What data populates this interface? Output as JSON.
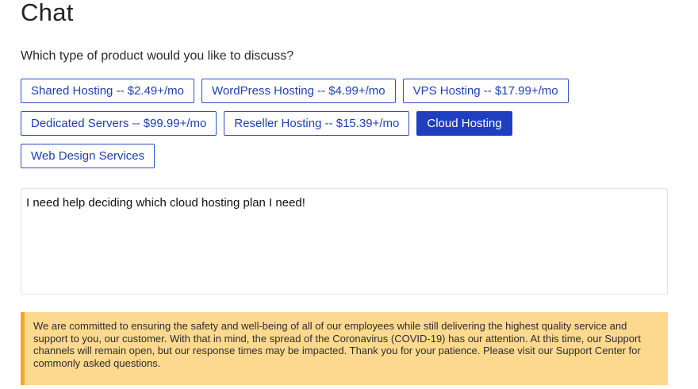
{
  "page": {
    "title": "Chat",
    "question": "Which type of product would you like to discuss?"
  },
  "products": [
    {
      "label": "Shared Hosting -- $2.49+/mo",
      "selected": false
    },
    {
      "label": "WordPress Hosting -- $4.99+/mo",
      "selected": false
    },
    {
      "label": "VPS Hosting -- $17.99+/mo",
      "selected": false
    },
    {
      "label": "Dedicated Servers -- $99.99+/mo",
      "selected": false
    },
    {
      "label": "Reseller Hosting -- $15.39+/mo",
      "selected": false
    },
    {
      "label": "Cloud Hosting",
      "selected": true
    },
    {
      "label": "Web Design Services",
      "selected": false
    }
  ],
  "message": {
    "value": "I need help deciding which cloud hosting plan I need!"
  },
  "notice": {
    "text": "We are committed to ensuring the safety and well-being of all of our employees while still delivering the highest quality service and support to you, our customer. With that in mind, the spread of the Coronavirus (COVID-19) has our attention. At this time, our Support channels will remain open, but our response times may be impacted. Thank you for your patience. Please visit our Support Center for commonly asked questions."
  },
  "colors": {
    "accent": "#1f3fc0",
    "notice_bg": "#fdd98f",
    "notice_border": "#f5a623"
  }
}
